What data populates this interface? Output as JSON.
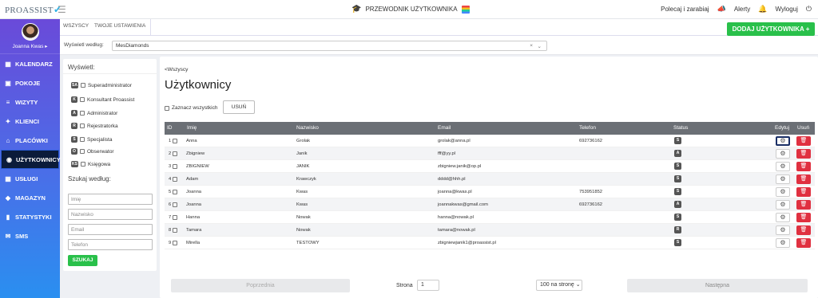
{
  "app": {
    "logo": "PROASSIST",
    "logo_mark": "✓"
  },
  "top": {
    "guide": "PRZEWODNIK UŻYTKOWNIKA",
    "refer": "Polecaj i zarabiaj",
    "alerts": "Alerty",
    "logout": "Wyloguj"
  },
  "profile": {
    "name": "Joanna Kwas ▸"
  },
  "sidebar": {
    "items": [
      {
        "label": "KALENDARZ",
        "icon": "calendar-icon"
      },
      {
        "label": "POKOJE",
        "icon": "rooms-icon"
      },
      {
        "label": "WIZYTY",
        "icon": "list-icon"
      },
      {
        "label": "KLIENCI",
        "icon": "clients-icon"
      },
      {
        "label": "PLACÓWKI",
        "icon": "building-icon"
      },
      {
        "label": "UŻYTKOWNICY",
        "icon": "user-icon",
        "active": true
      },
      {
        "label": "USŁUGI",
        "icon": "grid-icon"
      },
      {
        "label": "MAGAZYN",
        "icon": "box-icon"
      },
      {
        "label": "STATYSTYKI",
        "icon": "chart-icon"
      },
      {
        "label": "SMS",
        "icon": "sms-icon"
      }
    ]
  },
  "tabs": {
    "t1": "WSZYSCY",
    "t2": "TWOJE USTAWIENIA"
  },
  "add_button": "DODAJ UŻYTKOWNIKA +",
  "filter": {
    "label": "Wyświetl według:",
    "value": "MesDiamonds",
    "clear": "×",
    "dropdown": "⌄"
  },
  "left": {
    "title": "Wyświetl:",
    "roles": [
      {
        "badge": "SA",
        "label": "Superadministrator"
      },
      {
        "badge": "K",
        "label": "Konsultant Proassist"
      },
      {
        "badge": "A",
        "label": "Administrator"
      },
      {
        "badge": "R",
        "label": "Rejestratorka"
      },
      {
        "badge": "S",
        "label": "Specjalista"
      },
      {
        "badge": "O",
        "label": "Obserwator"
      },
      {
        "badge": "KS",
        "label": "Księgowa"
      }
    ],
    "search_title": "Szukaj według:",
    "inputs": {
      "name": "Imię",
      "surname": "Nazwisko",
      "email": "Email",
      "phone": "Telefon"
    },
    "search_button": "SZUKAJ"
  },
  "main": {
    "breadcrumb": "<Wszyscy",
    "title": "Użytkownicy",
    "select_all": "Zaznacz wszystkich",
    "delete": "USUŃ",
    "headers": {
      "id": "ID",
      "name": "Imię",
      "surname": "Nazwisko",
      "email": "Email",
      "phone": "Telefon",
      "status": "Status",
      "edit": "Edytuj",
      "remove": "Usuń"
    },
    "rows": [
      {
        "id": "1",
        "name": "Anna",
        "surname": "Grolak",
        "email": "grolak@anna.pl",
        "phone": "692736162",
        "status": "S"
      },
      {
        "id": "2",
        "name": "Zbigniew",
        "surname": "Janik",
        "email": "fff@yy.pl",
        "phone": "",
        "status": "A"
      },
      {
        "id": "3",
        "name": "ZBIGNIEW",
        "surname": "JANIK",
        "email": "zbigniew.janik@op.pl",
        "phone": "",
        "status": "S"
      },
      {
        "id": "4",
        "name": "Adam",
        "surname": "Krawczyk",
        "email": "dddd@hhh.pl",
        "phone": "",
        "status": "S"
      },
      {
        "id": "5",
        "name": "Joanna",
        "surname": "Kwas",
        "email": "joanna@kwas.pl",
        "phone": "753951852",
        "status": "S"
      },
      {
        "id": "6",
        "name": "Joanna",
        "surname": "Kwas",
        "email": "joannakwas@gmail.com",
        "phone": "692736162",
        "status": "A"
      },
      {
        "id": "7",
        "name": "Hanna",
        "surname": "Nowak",
        "email": "hanna@nowak.pl",
        "phone": "",
        "status": "S"
      },
      {
        "id": "8",
        "name": "Tamara",
        "surname": "Nowak",
        "email": "tamara@nowak.pl",
        "phone": "",
        "status": "R"
      },
      {
        "id": "9",
        "name": "Mirella",
        "surname": "TESTOWY",
        "email": "zbigniewjanik1@proassist.pl",
        "phone": "",
        "status": "S"
      }
    ],
    "pager": {
      "prev": "Poprzednia",
      "page_label": "Strona",
      "page": "1",
      "per_page": "100 na stronę ⌄",
      "next": "Następna"
    }
  },
  "colors": {
    "accent": "#29c04a",
    "sidebar_top": "#6a4ad9",
    "sidebar_bottom": "#2a8ff0",
    "danger": "#e03040"
  }
}
